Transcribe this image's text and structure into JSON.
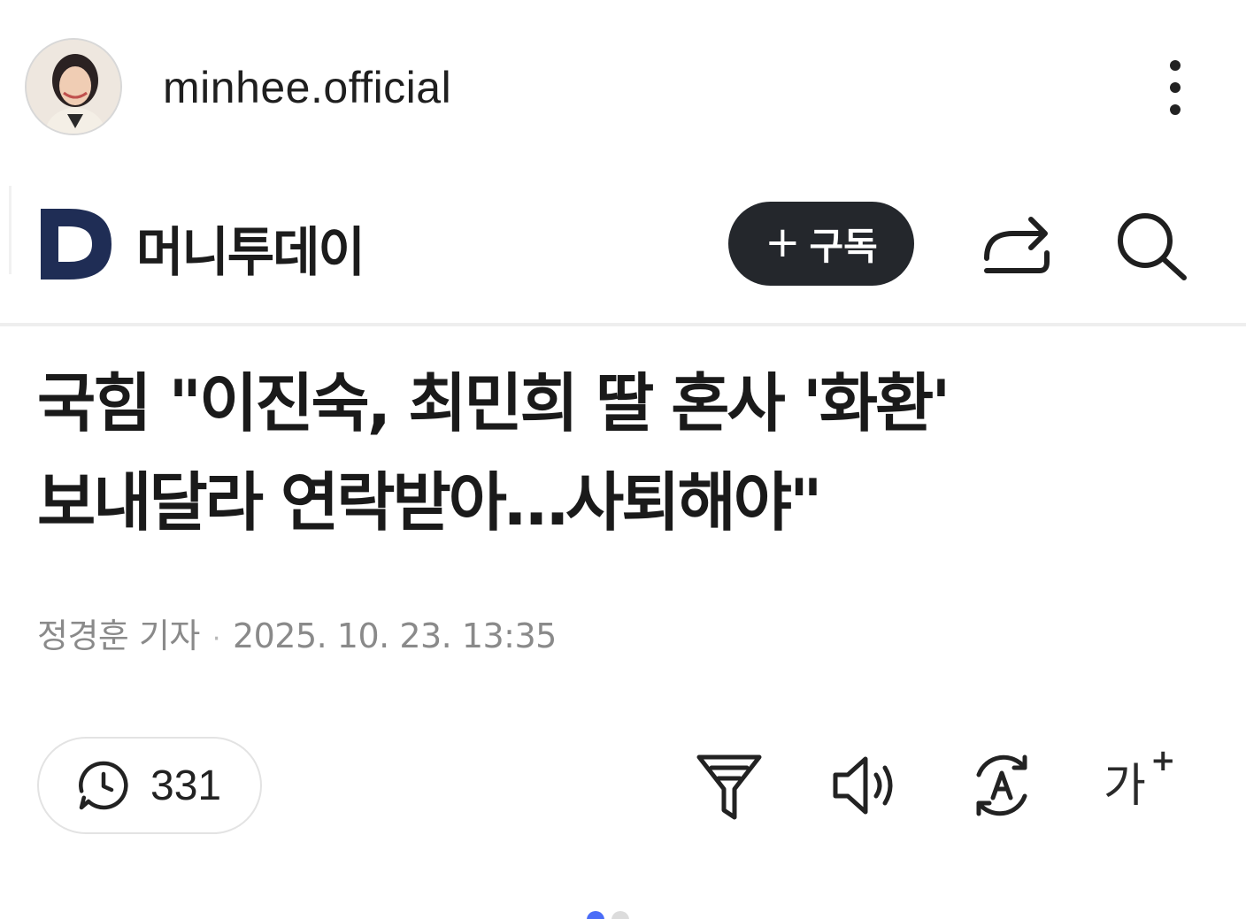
{
  "post": {
    "username": "minhee.official",
    "avatar_icon": "profile-photo",
    "more_icon": "vertical-ellipsis-icon"
  },
  "article_bar": {
    "brand_logo_letter": "D",
    "brand_name": "머니투데이",
    "subscribe_plus": "+",
    "subscribe_label": "구독",
    "share_icon": "share-icon",
    "search_icon": "search-icon",
    "brand_color": "#1f2d55"
  },
  "headline": {
    "line1": "국힘 \"이진숙, 최민희 딸 혼사 '화환'",
    "line2": "보내달라 연락받아…사퇴해야\""
  },
  "byline": {
    "reporter": "정경훈 기자",
    "separator": "·",
    "datetime": "2025. 10. 23. 13:35"
  },
  "toolbar": {
    "comment_count": "331",
    "comment_icon": "comment-clock-icon",
    "filter_icon": "filter-icon",
    "audio_icon": "speaker-icon",
    "translate_icon": "translate-icon",
    "fontsize_label": "가",
    "fontsize_plus": "+"
  },
  "carousel": {
    "total": 2,
    "active_index": 0,
    "active_color": "#4a6cf7"
  }
}
